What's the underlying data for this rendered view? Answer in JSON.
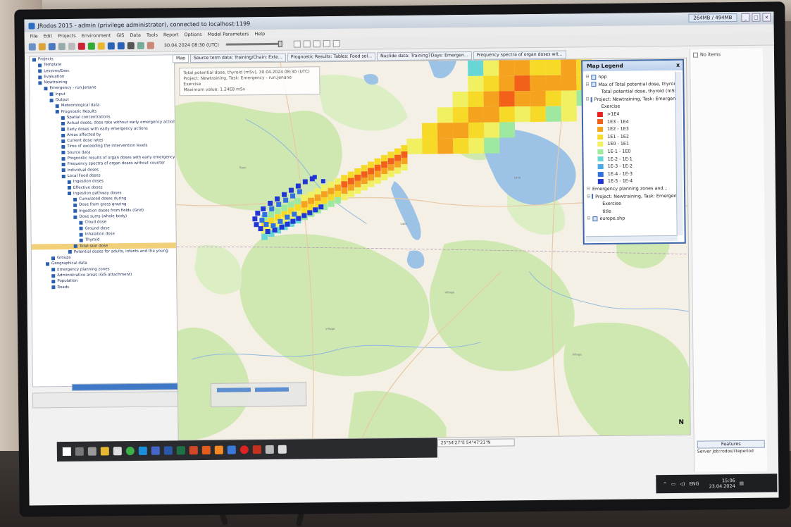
{
  "window": {
    "title": "JRodos 2015 - admin (privilege administrator), connected to localhost:1199",
    "memory": "264MB / 494MB"
  },
  "menu": [
    "File",
    "Edit",
    "Projects",
    "Environment",
    "GIS",
    "Data",
    "Tools",
    "Report",
    "Options",
    "Model Parameters",
    "Help"
  ],
  "toolbar": {
    "time": "30.04.2024 08:30 (UTC)"
  },
  "tabs": [
    "Map",
    "Source term data: Training/Chain: Exte...",
    "Prognostic Results: Tables: Food sol...",
    "Nuclide data: Training7Days: Emergen...",
    "Frequency spectra of organ doses wit..."
  ],
  "map": {
    "info_lines": [
      "Total potential dose, thyroid (mSv), 30.04.2024 08:30 (UTC)",
      "Project: Newtraining, Task: Emergency - run.Jenane",
      "Exercise",
      "Maximum value: 1.24E8 mSv"
    ],
    "compass": "N",
    "coordinates": "25°54'27\"E 54°47'21\"N"
  },
  "legend": {
    "title": "Map Legend",
    "close": "x",
    "layers": [
      {
        "label": "npp",
        "checked": true
      },
      {
        "label": "Max of Total potential dose, thyroid",
        "checked": true
      },
      {
        "label": "Total potential dose, thyroid (mSv)",
        "checked": false,
        "sub": true
      },
      {
        "label": "Project: Newtraining, Task: Emergency",
        "checked": true
      },
      {
        "label": "Exercise",
        "checked": false,
        "sub": true
      }
    ],
    "classes": [
      {
        "label": ">1E4",
        "color": "#e8201a"
      },
      {
        "label": "1E3 - 1E4",
        "color": "#f2601a"
      },
      {
        "label": "1E2 - 1E3",
        "color": "#f5a21e"
      },
      {
        "label": "1E1 - 1E2",
        "color": "#f7d928"
      },
      {
        "label": "1E0 - 1E1",
        "color": "#f0f060"
      },
      {
        "label": "1E-1 - 1E0",
        "color": "#9fe8a0"
      },
      {
        "label": "1E-2 - 1E-1",
        "color": "#69d6d6"
      },
      {
        "label": "1E-3 - 1E-2",
        "color": "#4aa9e8"
      },
      {
        "label": "1E-4 - 1E-3",
        "color": "#3272e0"
      },
      {
        "label": "1E-5 - 1E-4",
        "color": "#2236d6"
      }
    ],
    "after": [
      {
        "label": "Emergency planning zones and...",
        "checked": false
      },
      {
        "label": "Project: Newtraining, Task: Emergency",
        "checked": true
      },
      {
        "label": "Exercise",
        "checked": false,
        "sub": true
      },
      {
        "label": "title",
        "checked": false,
        "sub": true
      },
      {
        "label": "europe.shp",
        "checked": true
      }
    ]
  },
  "right_panel": {
    "no_items": "No items",
    "features": "Features",
    "server_job": "Server Job:rodos/ilteperiod"
  },
  "tray": {
    "lang": "ENG",
    "time": "15:06",
    "date": "23.04.2024"
  },
  "tree": [
    "Projects",
    "Template",
    "Lessons/Exec",
    "Evaluation",
    "Newtraining",
    "Emergency - run.Jenane",
    "Input",
    "Output",
    "Meteorological data",
    "Prognostic Results",
    "Spatial concentrations",
    "Actual doses, dose rate without early emergency actions",
    "Early doses with early emergency actions",
    "Areas affected by",
    "Current dose rates",
    "Time of exceeding the intervention levels",
    "Source data",
    "Prognostic results of organ doses with early emergency",
    "Frequency spectra of organ doses without counter",
    "Individual doses",
    "Local Food doses",
    "Ingestion doses",
    "Effective doses",
    "Ingestion pathway doses",
    "Cumulated doses during",
    "Dose from grass grazing",
    "Ingestion doses from fields (Grid)",
    "Dose sums (whole body)",
    "Cloud dose",
    "Ground dose",
    "Inhalation dose",
    "Thyroid",
    "Total skin dose",
    "Potential doses for adults, infants and the young",
    "Groups",
    "Geographical data",
    "Emergency planning zones",
    "Administrative areas (GIS attachment)",
    "Population",
    "Roads"
  ]
}
